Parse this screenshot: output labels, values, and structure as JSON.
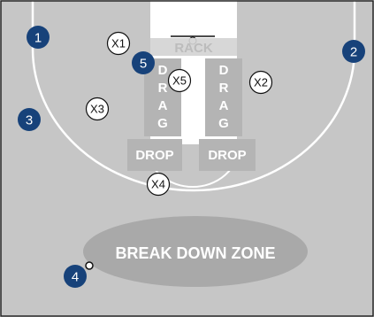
{
  "court": {
    "floor_color": "#c6c6c6",
    "lane_color": "#ffffff",
    "line_color": "#ffffff",
    "zone_color": "#a9a9a9",
    "label_box_color": "#b4b4b4",
    "offense_color": "#17427a",
    "defense_fill": "#ffffff"
  },
  "labels": {
    "rack": "RACK",
    "drag_left": [
      "D",
      "R",
      "A",
      "G"
    ],
    "drag_right": [
      "D",
      "R",
      "A",
      "G"
    ],
    "drop_left": "DROP",
    "drop_right": "DROP",
    "break_down_zone": "BREAK DOWN ZONE"
  },
  "offense": [
    "1",
    "2",
    "3",
    "4",
    "5"
  ],
  "defense": [
    "X1",
    "X2",
    "X3",
    "X4",
    "X5"
  ]
}
